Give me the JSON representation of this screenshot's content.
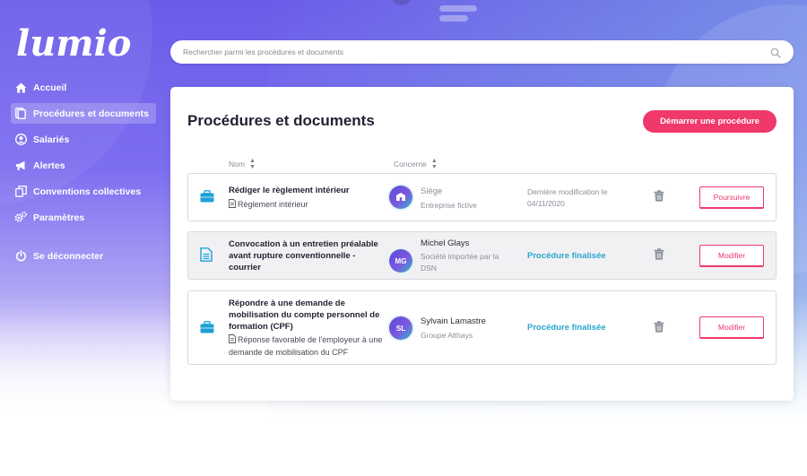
{
  "app": {
    "logo_text": "lumio",
    "colors": {
      "accent": "#f0386b",
      "brand": "#6a5ce8",
      "status": "#2aa6cf"
    }
  },
  "sidebar": {
    "items": [
      {
        "label": "Accueil",
        "icon": "home-icon"
      },
      {
        "label": "Procédures et documents",
        "icon": "documents-icon",
        "active": true
      },
      {
        "label": "Salariés",
        "icon": "user-circle-icon"
      },
      {
        "label": "Alertes",
        "icon": "megaphone-icon"
      },
      {
        "label": "Conventions collectives",
        "icon": "copy-icon"
      },
      {
        "label": "Paramètres",
        "icon": "gears-icon"
      }
    ],
    "logout": {
      "label": "Se déconnecter",
      "icon": "power-icon"
    }
  },
  "search": {
    "placeholder": "Rechercher parmi les procédures et documents",
    "icon": "search-icon"
  },
  "main": {
    "title": "Procédures et documents",
    "start_button": "Démarrer une procédure",
    "columns": {
      "name": "Nom",
      "concerne": "Concerne"
    },
    "rows": [
      {
        "type_icon": "briefcase-icon",
        "title": "Rédiger le règlement intérieur",
        "subtitle": "Règlement intérieur",
        "avatar_initials": "",
        "avatar_icon": "building-icon",
        "who_name": "Siège",
        "who_org": "Entreprise fictive",
        "modified_label": "Dernière modification le",
        "modified_date": "04/11/2020",
        "action": "Poursuivre"
      },
      {
        "type_icon": "document-icon",
        "title": "Convocation à un entretien préalable avant rupture conventionnelle - courrier",
        "subtitle": "",
        "avatar_initials": "MG",
        "who_name": "Michel Glays",
        "who_org": "Société importée par la DSN",
        "status": "Procédure finalisée",
        "action": "Modifier"
      },
      {
        "type_icon": "briefcase-icon",
        "title": "Répondre à une demande de mobilisation du compte personnel de formation (CPF)",
        "subtitle": "Réponse favorable de l'employeur à une demande de mobilisation du CPF",
        "avatar_initials": "SL",
        "who_name": "Sylvain Lamastre",
        "who_org": "Groupe Althays",
        "status": "Procédure finalisée",
        "action": "Modifier"
      }
    ]
  }
}
